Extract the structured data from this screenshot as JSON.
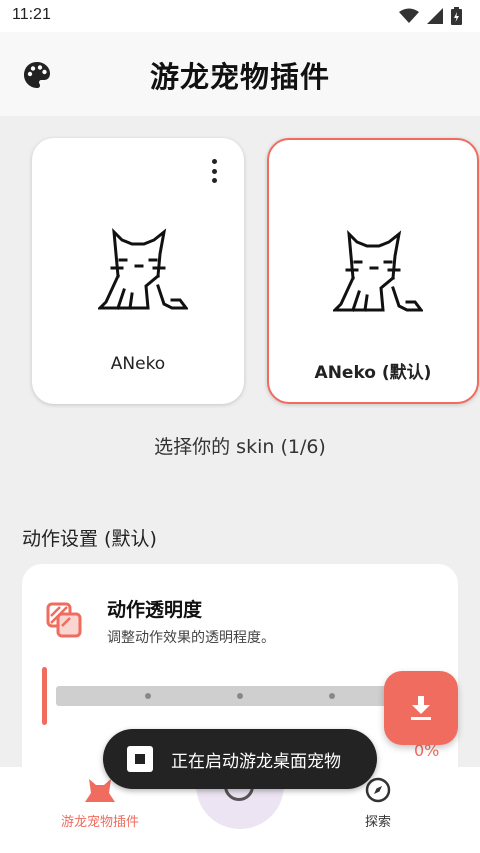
{
  "status_bar": {
    "time": "11:21"
  },
  "app_bar": {
    "title": "游龙宠物插件",
    "palette_icon": "palette-icon"
  },
  "skins": [
    {
      "name": "ANeko",
      "selected": false
    },
    {
      "name": "ANeko (默认)",
      "selected": true
    }
  ],
  "skin_caption": "选择你的 skin (1/6)",
  "action_settings": {
    "section_title": "动作设置 (默认)",
    "opacity_title": "动作透明度",
    "opacity_desc": "调整动作效果的透明程度。",
    "opacity_value": "0%"
  },
  "toast": {
    "text": "正在启动游龙桌面宠物"
  },
  "bottom_nav": {
    "home_label": "游龙宠物插件",
    "explore_label": "探索"
  },
  "colors": {
    "accent": "#f06c5e",
    "selected_nav_bg": "#ece4f2"
  }
}
